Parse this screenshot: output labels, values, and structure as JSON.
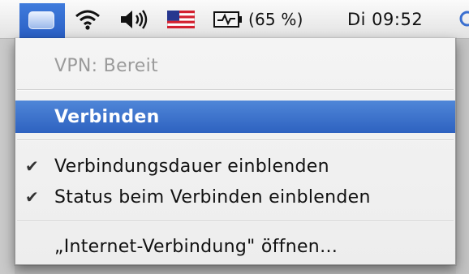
{
  "menubar": {
    "vpn_icon": "vpn-screen-icon",
    "wifi_icon": "wifi-icon",
    "volume_icon": "volume-icon",
    "flag_icon": "us-flag-icon",
    "battery_icon": "battery-charging-icon",
    "battery_text": "(65 %)",
    "clock": "Di 09:52",
    "accent_color": "#2f63c4"
  },
  "menu": {
    "status": "VPN: Bereit",
    "connect": "Verbinden",
    "show_duration": "Verbindungsdauer einblenden",
    "show_status": "Status beim Verbinden einblenden",
    "open_internet_connect": "„Internet-Verbindung\" öffnen…",
    "checkmark": "✔"
  }
}
